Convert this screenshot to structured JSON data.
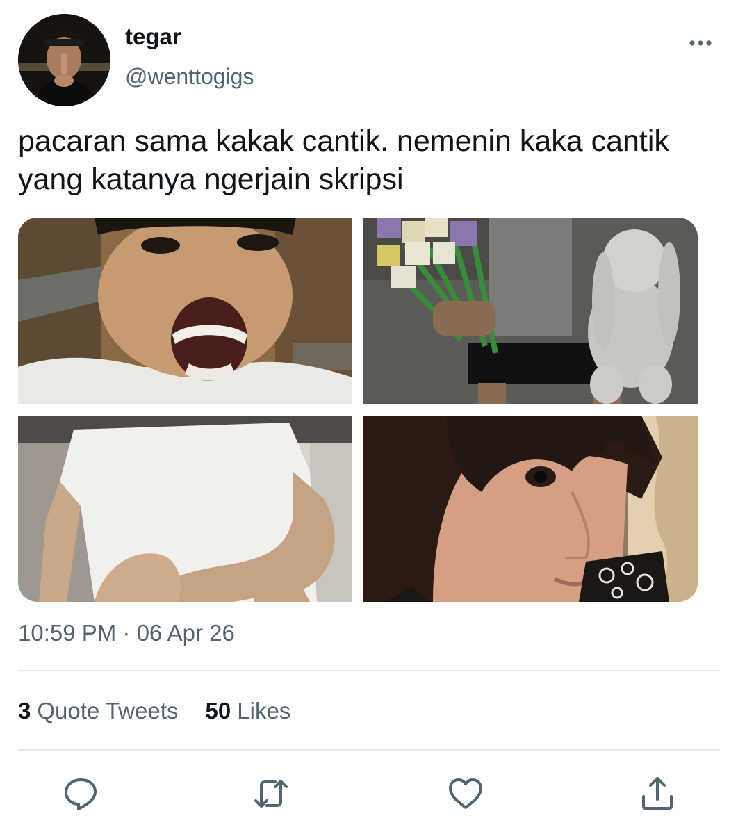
{
  "user": {
    "display_name": "tegar",
    "handle": "@wenttogigs",
    "avatar": "profile-photo"
  },
  "tweet": {
    "text": "pacaran sama kakak cantik. nemenin kaka cantik yang katanya ngerjain skripsi",
    "timestamp": "10:59 PM · 06 Apr 26",
    "media": [
      {
        "subject": "selfie-open-mouth-photo"
      },
      {
        "subject": "tulips-and-bunny-plush-photo"
      },
      {
        "subject": "white-tshirt-arms-photo"
      },
      {
        "subject": "bob-haircut-closeup-photo"
      }
    ]
  },
  "stats": [
    {
      "count": "3",
      "label": "Quote Tweets"
    },
    {
      "count": "50",
      "label": "Likes"
    }
  ],
  "actions": [
    {
      "icon": "reply-icon"
    },
    {
      "icon": "retweet-icon"
    },
    {
      "icon": "like-icon"
    },
    {
      "icon": "share-icon"
    }
  ],
  "menu": {
    "icon": "more-options-icon"
  },
  "colors": {
    "text_primary": "#0f1419",
    "text_secondary": "#536471",
    "divider": "#e6eaed"
  }
}
